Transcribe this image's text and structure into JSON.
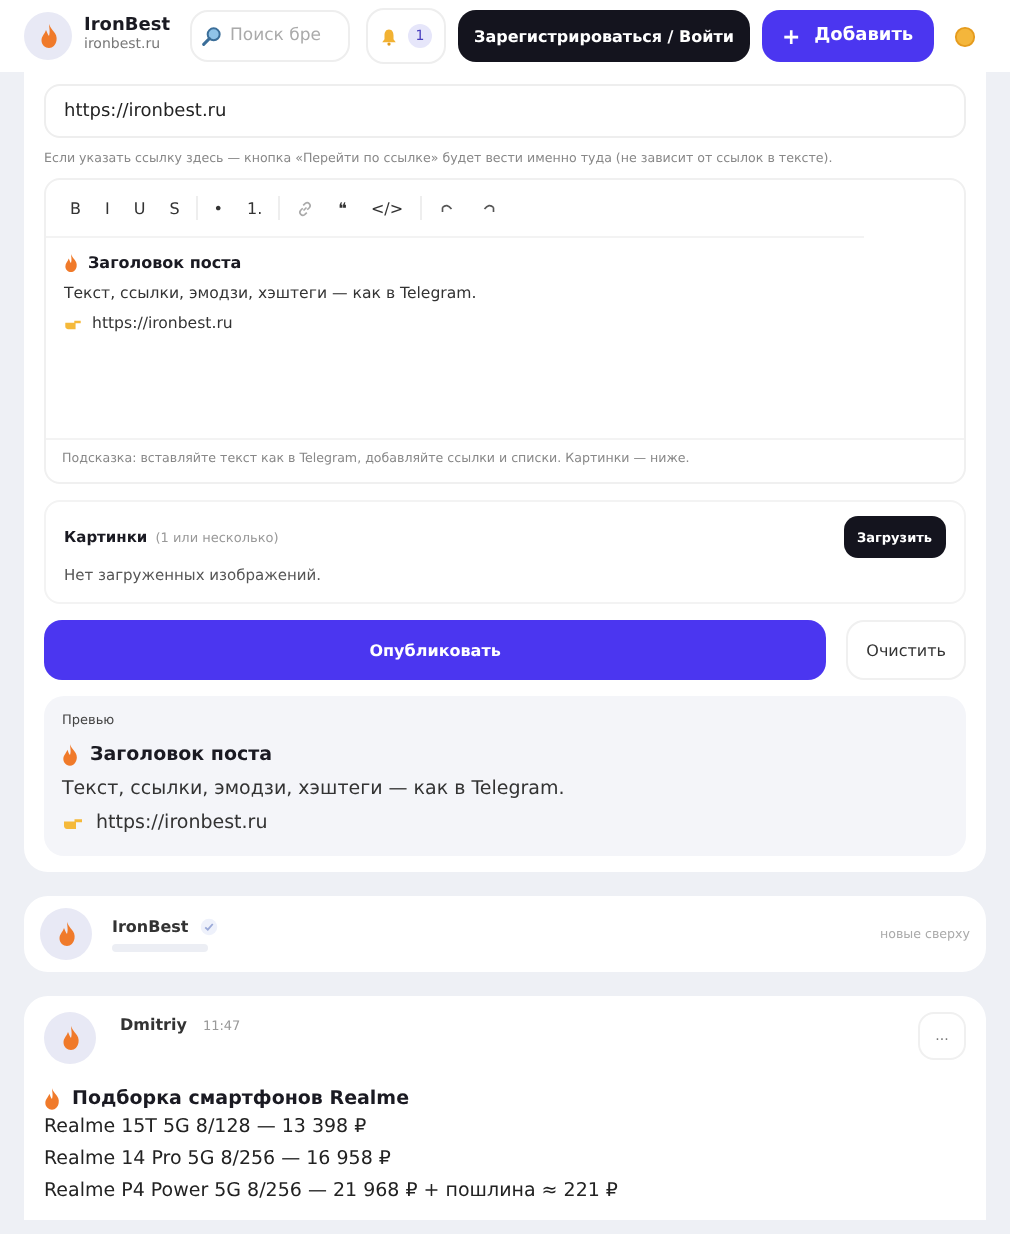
{
  "header": {
    "logo": {
      "name": "IronBest",
      "domain": "ironbest.ru"
    },
    "search": {
      "placeholder": "Поиск бре"
    },
    "notifications": {
      "count": "1"
    },
    "login_button": "Зарегистрироваться / Войти",
    "add_button": {
      "icon": "+",
      "label": "Добавить"
    }
  },
  "composer": {
    "link_field": {
      "value": "https://ironbest.ru"
    },
    "link_hint": "Если указать ссылку здесь — кнопка «Перейти по ссылке» будет вести именно туда (не зависит от ссылок в тексте).",
    "editor": {
      "toolbar": [
        [
          {
            "kind": "text",
            "label": "B"
          },
          {
            "kind": "text",
            "label": "I"
          },
          {
            "kind": "text",
            "label": "U"
          },
          {
            "kind": "text",
            "label": "S"
          }
        ],
        [
          {
            "kind": "text",
            "label": "•"
          },
          {
            "kind": "text",
            "label": "1."
          }
        ],
        [
          {
            "kind": "link"
          },
          {
            "kind": "text",
            "label": "❝"
          },
          {
            "kind": "text",
            "label": "</>"
          }
        ],
        [
          {
            "kind": "undo"
          },
          {
            "kind": "redo"
          }
        ]
      ],
      "content": {
        "title": "Заголовок поста",
        "text": "Текст, ссылки, эмодзи, хэштеги — как в Telegram.",
        "link": "https://ironbest.ru"
      },
      "hint": "Подсказка: вставляйте текст как в Telegram, добавляйте ссылки и списки. Картинки — ниже."
    },
    "images": {
      "title": "Картинки",
      "note": "(1 или несколько)",
      "upload_button": "Загрузить",
      "empty": "Нет загруженных изображений."
    },
    "publish_button": "Опубликовать",
    "clear_button": "Очистить",
    "preview": {
      "label": "Превью",
      "title": "Заголовок поста",
      "text": "Текст, ссылки, эмодзи, хэштеги — как в Telegram.",
      "link": "https://ironbest.ru"
    }
  },
  "channel": {
    "name": "IronBest",
    "verified": true,
    "sort": "новые сверху"
  },
  "post": {
    "author": "Dmitriy",
    "time": "11:47",
    "menu": "...",
    "title": "Подборка смартфонов Realme",
    "lines": [
      "Realme 15T 5G 8/128 — 13 398 ₽",
      "Realme 14 Pro 5G 8/256 — 16 958 ₽",
      "Realme P4 Power 5G 8/256 — 21 968 ₽ + пошлина ≈ 221 ₽"
    ]
  }
}
